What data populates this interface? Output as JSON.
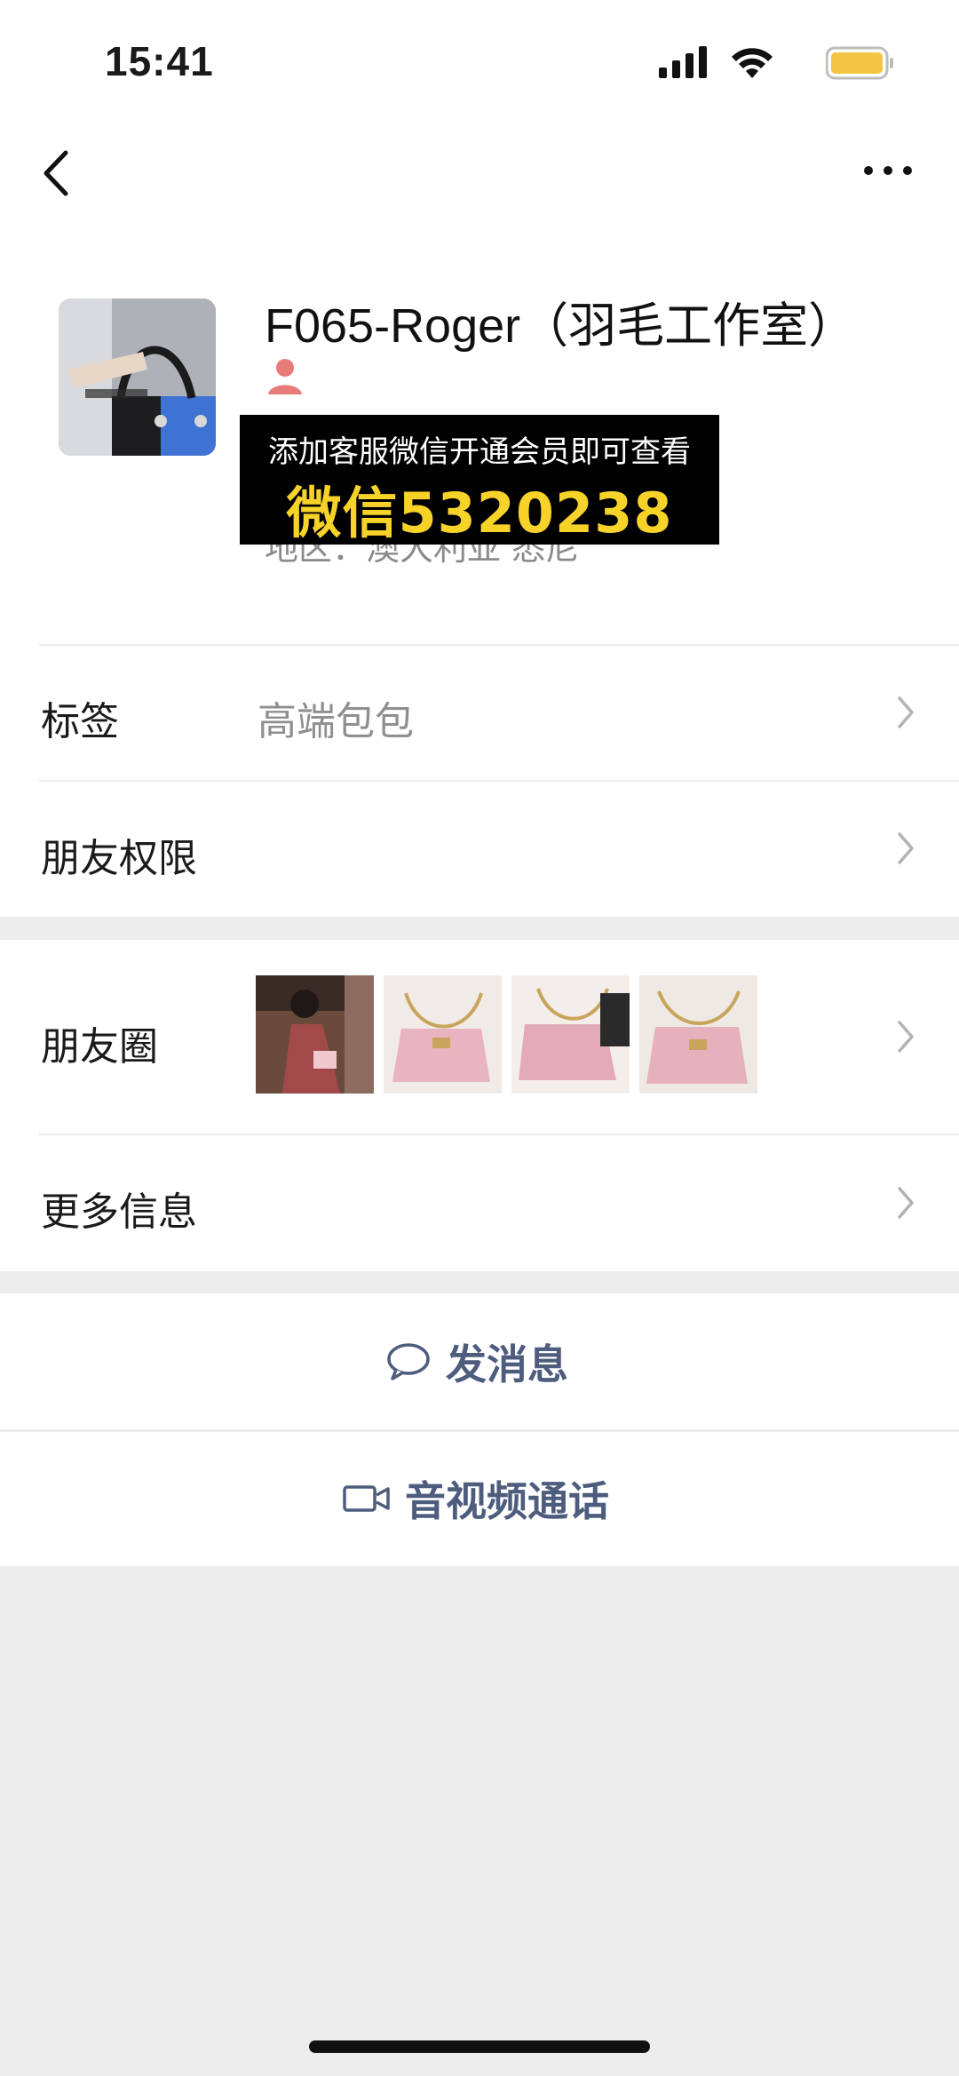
{
  "status_bar": {
    "time": "15:41"
  },
  "nav": {
    "back_icon": "chevron-left-icon",
    "more_icon": "ellipsis-icon"
  },
  "profile": {
    "display_name": "F065-Roger（羽毛工作室）",
    "gender_icon": "female-user-icon",
    "region": "地区：澳大利亚 悉尼",
    "promo_line1": "添加客服微信开通会员即可查看",
    "promo_line2": "微信5320238"
  },
  "rows": {
    "tags_label": "标签",
    "tags_value": "高端包包",
    "permissions_label": "朋友权限",
    "moments_label": "朋友圈",
    "more_info_label": "更多信息"
  },
  "actions": {
    "message_label": "发消息",
    "call_label": "音视频通话"
  },
  "colors": {
    "link": "#4e5c7d",
    "promo_yellow": "#f7d229",
    "battery": "#f4c542",
    "female_icon": "#e87a7a"
  }
}
